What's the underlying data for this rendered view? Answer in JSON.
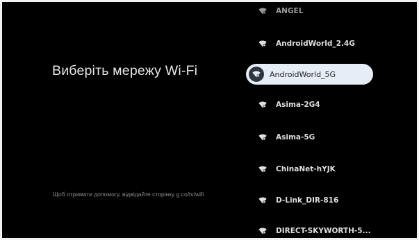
{
  "title": "Виберіть мережу Wi-Fi",
  "help_text": "Щоб отримати допомогу, відвідайте сторінку g.co/tv/wifi",
  "networks": [
    {
      "ssid": "ANGEL",
      "icon": "wifi-lock-icon"
    },
    {
      "ssid": "AndroidWorld_2.4G",
      "icon": "wifi-lock-icon"
    },
    {
      "ssid": "AndroidWorld_5G",
      "icon": "wifi-lock-icon",
      "focused": true
    },
    {
      "ssid": "Asima-2G4",
      "icon": "wifi-lock-icon"
    },
    {
      "ssid": "Asima-5G",
      "icon": "wifi-lock-icon"
    },
    {
      "ssid": "ChinaNet-hYJK",
      "icon": "wifi-lock-icon"
    },
    {
      "ssid": "D-Link_DIR-816",
      "icon": "wifi-lock-icon"
    },
    {
      "ssid": "DIRECT-SKYWORTH-5...",
      "icon": "wifi-lock-icon"
    }
  ],
  "colors": {
    "background": "#000000",
    "focus_pill": "#e6edf6",
    "focus_icon_bg": "#2f3642",
    "text": "#dedede"
  }
}
